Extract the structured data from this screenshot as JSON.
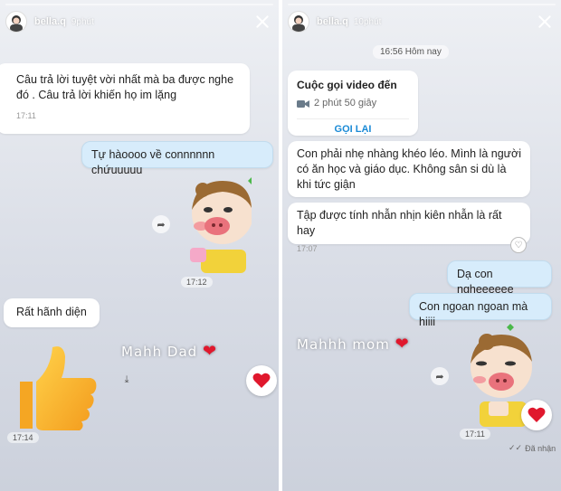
{
  "left": {
    "username": "bella.q",
    "post_time": "9phút",
    "msg1": {
      "text": "Câu trả lời tuyệt vời nhất mà ba được nghe đó . Câu trả lời khiến họ im lặng",
      "time": "17:11"
    },
    "msg2": {
      "text": "Tự hàoooo về connnnnn chứuuuuu"
    },
    "sticker_time": "17:12",
    "msg3": {
      "text": "Rất hãnh diện"
    },
    "caption": "Mahh Dad",
    "thumb_time": "17:14"
  },
  "right": {
    "username": "bella.q",
    "post_time": "10phút",
    "date_chip": "16:56 Hôm nay",
    "call": {
      "title": "Cuộc gọi video đến",
      "duration": "2 phút 50 giây",
      "action": "GỌI LẠI"
    },
    "msg1": {
      "text": "Con phải nhẹ nhàng khéo léo. Mình là người có ăn học và giáo dục. Không sân si dù là khi tức giận"
    },
    "msg2": {
      "text": "Tập được tính nhẫn nhịn kiên nhẫn là rất hay",
      "time": "17:07"
    },
    "msg3": {
      "text": "Dạ con ngheeeeee"
    },
    "msg4": {
      "text": "Con ngoan ngoan mà hiiii"
    },
    "caption": "Mahhh mom",
    "sticker_time": "17:11",
    "status": "Đã nhận"
  },
  "colors": {
    "heart": "#e0182d",
    "accent": "#1a8ad6",
    "sent_bubble": "#d7ecfb"
  },
  "icons": [
    "close-icon",
    "heart-icon",
    "share-icon",
    "thumbs-up-icon",
    "video-call-icon",
    "download-icon"
  ]
}
